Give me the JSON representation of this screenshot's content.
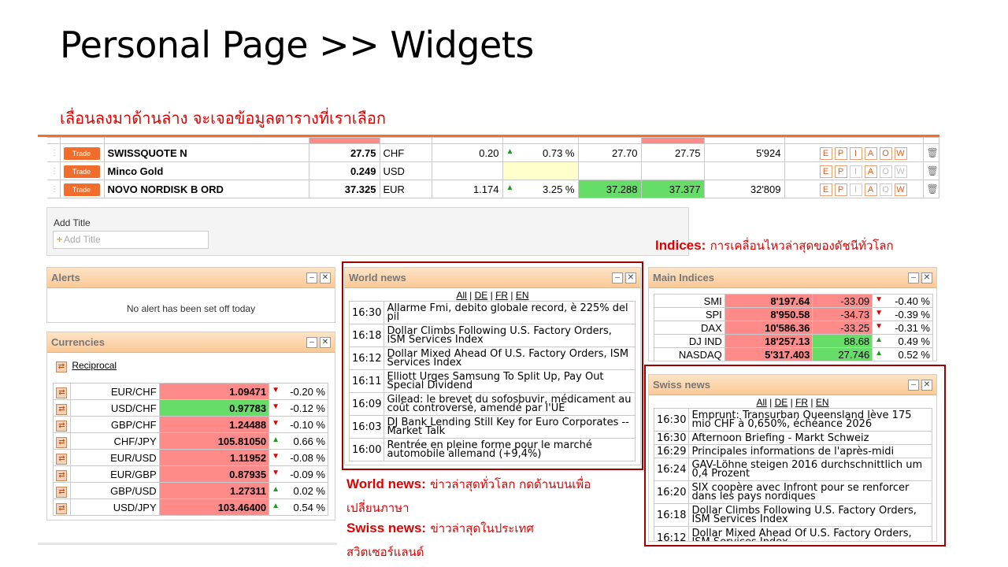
{
  "slide": {
    "title": "Personal Page >> Widgets",
    "subtitle": "เลื่อนลงมาด้านล่าง จะเจอข้อมูลตารางที่เราเลือก",
    "indices_note": {
      "label": "Indices:",
      "text": "การเคลื่อนไหวล่าสุดของดัชนีทั่วโลก"
    },
    "world_note": {
      "label": "World news:",
      "text_line1": "ข่าวล่าสุดทั่วโลก กดด้านบนเพื่อ",
      "text_line2": "เปลี่ยนภาษา"
    },
    "swiss_note": {
      "label": "Swiss news:",
      "text_line1": "ข่าวล่าสุดในประเทศ",
      "text_line2": "สวิตเซอร์แลนด์"
    }
  },
  "trades": {
    "button_label": "Trade",
    "grip_icon": "drag-handle-icon",
    "action_letters": [
      "E",
      "P",
      "I",
      "A",
      "O",
      "W"
    ],
    "rows": [
      {
        "name": "SWISSQUOTE N",
        "price": "27.75",
        "currency": "CHF",
        "change": "0.20",
        "pct": "0.73 %",
        "bid": "27.70",
        "ask": "27.75",
        "volume": "5'924"
      },
      {
        "name": "Minco Gold",
        "price": "0.249",
        "currency": "USD",
        "change": "",
        "pct": "",
        "bid": "",
        "ask": "",
        "volume": ""
      },
      {
        "name": "NOVO NORDISK B ORD",
        "price": "37.325",
        "currency": "EUR",
        "change": "1.174",
        "pct": "3.25 %",
        "bid": "37.288",
        "ask": "37.377",
        "volume": "32'809"
      }
    ]
  },
  "add_title": {
    "label": "Add Title",
    "placeholder": "Add Title"
  },
  "alerts": {
    "title": "Alerts",
    "message": "No alert has been set off today"
  },
  "currencies": {
    "title": "Currencies",
    "reciprocal": "Reciprocal",
    "rows": [
      {
        "pair": "EUR/CHF",
        "value": "1.09471",
        "change": "-0.20 %",
        "dir": "down"
      },
      {
        "pair": "USD/CHF",
        "value": "0.97783",
        "change": "-0.12 %",
        "dir": "down"
      },
      {
        "pair": "GBP/CHF",
        "value": "1.24488",
        "change": "-0.10 %",
        "dir": "down"
      },
      {
        "pair": "CHF/JPY",
        "value": "105.81050",
        "change": "0.66 %",
        "dir": "up"
      },
      {
        "pair": "EUR/USD",
        "value": "1.11952",
        "change": "-0.08 %",
        "dir": "down"
      },
      {
        "pair": "EUR/GBP",
        "value": "0.87935",
        "change": "-0.09 %",
        "dir": "down"
      },
      {
        "pair": "GBP/USD",
        "value": "1.27311",
        "change": "0.02 %",
        "dir": "up"
      },
      {
        "pair": "USD/JPY",
        "value": "103.46400",
        "change": "0.54 %",
        "dir": "up"
      }
    ]
  },
  "world_news": {
    "title": "World news",
    "langs": [
      "All",
      "DE",
      "FR",
      "EN"
    ],
    "items": [
      {
        "time": "16:30",
        "text": "Allarme Fmi, debito globale record, è 225% del pil"
      },
      {
        "time": "16:18",
        "text": "Dollar Climbs Following U.S. Factory Orders, ISM Services Index"
      },
      {
        "time": "16:12",
        "text": "Dollar Mixed Ahead Of U.S. Factory Orders, ISM Services Index"
      },
      {
        "time": "16:11",
        "text": "Elliott Urges Samsung To Split Up, Pay Out Special Dividend"
      },
      {
        "time": "16:09",
        "text": "Gilead: le brevet du sofosbuvir, médicament au coût controversé, amendé par l'UE"
      },
      {
        "time": "16:03",
        "text": "DJ Bank Lending Still Key for Euro Corporates -- Market Talk"
      },
      {
        "time": "16:00",
        "text": "Rentrée en pleine forme pour le marché automobile allemand (+9,4%)"
      }
    ]
  },
  "main_indices": {
    "title": "Main Indices",
    "rows": [
      {
        "name": "SMI",
        "value": "8'197.64",
        "change": "-33.09",
        "pct": "-0.40 %",
        "dir": "down"
      },
      {
        "name": "SPI",
        "value": "8'950.58",
        "change": "-34.73",
        "pct": "-0.39 %",
        "dir": "down"
      },
      {
        "name": "DAX",
        "value": "10'586.36",
        "change": "-33.25",
        "pct": "-0.31 %",
        "dir": "down"
      },
      {
        "name": "DJ IND",
        "value": "18'257.13",
        "change": "88.68",
        "pct": "0.49 %",
        "dir": "up"
      },
      {
        "name": "NASDAQ",
        "value": "5'317.403",
        "change": "27.746",
        "pct": "0.52 %",
        "dir": "up"
      }
    ]
  },
  "swiss_news": {
    "title": "Swiss news",
    "langs": [
      "All",
      "DE",
      "FR",
      "EN"
    ],
    "items": [
      {
        "time": "16:30",
        "text": "Emprunt: Transurban Queensland lève 175 mio CHF à 0,650%, échéance 2026"
      },
      {
        "time": "16:30",
        "text": "Afternoon Briefing - Markt Schweiz"
      },
      {
        "time": "16:29",
        "text": "Principales informations de l'après-midi"
      },
      {
        "time": "16:24",
        "text": "GAV-Löhne steigen 2016 durchschnittlich um 0,4 Prozent"
      },
      {
        "time": "16:20",
        "text": "SIX coopère avec Infront pour se renforcer dans les pays nordiques"
      },
      {
        "time": "16:18",
        "text": "Dollar Climbs Following U.S. Factory Orders, ISM Services Index"
      },
      {
        "time": "16:12",
        "text": "Dollar Mixed Ahead Of U.S. Factory Orders, ISM Services Index"
      }
    ]
  },
  "widget_controls": {
    "minimize": "–",
    "close": "✕"
  },
  "colors": {
    "accent_orange": "#f26d2b",
    "up_green": "#66dd66",
    "down_red": "#ff8a8a",
    "annotation_red": "#e00000",
    "frame_red": "#a00000"
  }
}
